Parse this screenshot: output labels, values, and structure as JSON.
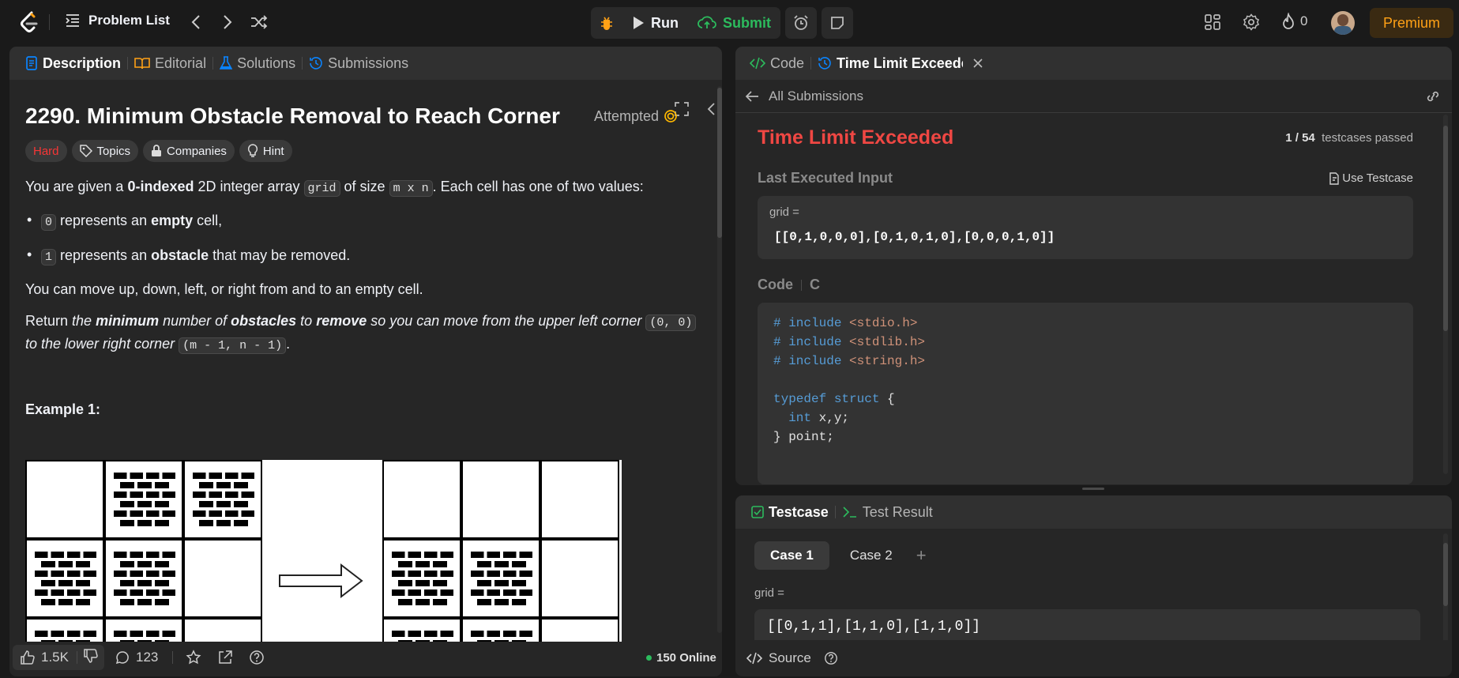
{
  "topbar": {
    "problem_list": "Problem List",
    "run": "Run",
    "submit": "Submit",
    "streak": "0",
    "premium": "Premium"
  },
  "left": {
    "tabs": [
      "Description",
      "Editorial",
      "Solutions",
      "Submissions"
    ],
    "title": "2290. Minimum Obstacle Removal to Reach Corner",
    "status": "Attempted",
    "difficulty": "Hard",
    "tags": [
      "Topics",
      "Companies",
      "Hint"
    ],
    "p1": {
      "a": "You are given a ",
      "b": "0-indexed",
      "c": " 2D integer array ",
      "code1": "grid",
      "d": " of size ",
      "code2": "m x n",
      "e": ". Each cell has one of two values:"
    },
    "b1": {
      "code": "0",
      "a": " represents an ",
      "b": "empty",
      "c": " cell,"
    },
    "b2": {
      "code": "1",
      "a": " represents an ",
      "b": "obstacle",
      "c": " that may be removed."
    },
    "p2": "You can move up, down, left, or right from and to an empty cell.",
    "p3": {
      "a": "Return ",
      "b": "the ",
      "c": "minimum",
      "d": " number of ",
      "e": "obstacles",
      "f": " to ",
      "g": "remove",
      "h": " so you can move from the upper left corner ",
      "code1": "(0, 0)",
      "i": " to the lower right corner ",
      "code2": "(m - 1, n - 1)",
      "j": "."
    },
    "example": "Example 1:",
    "footer": {
      "likes": "1.5K",
      "comments": "123",
      "online": "150 Online"
    }
  },
  "right_top": {
    "tabs": [
      "Code",
      "Time Limit Exceeded"
    ],
    "back": "All Submissions",
    "verdict": "Time Limit Exceeded",
    "passed": "1 / 54",
    "passed_label": "testcases passed",
    "last_input_label": "Last Executed Input",
    "use_testcase": "Use Testcase",
    "input_var": "grid =",
    "input_value": "[[0,1,0,0,0],[0,1,0,1,0],[0,0,0,1,0]]",
    "code_label": "Code",
    "lang": "C",
    "code_lines": [
      {
        "kw": "# include ",
        "str": "<stdio.h>"
      },
      {
        "kw": "# include ",
        "str": "<stdlib.h>"
      },
      {
        "kw": "# include ",
        "str": "<string.h>"
      },
      {
        "kw": "",
        "str": ""
      },
      {
        "kw": "typedef struct",
        "rest": " {"
      },
      {
        "kw": "  int",
        "rest": " x,y;"
      },
      {
        "kw": "",
        "rest": "} point;"
      }
    ]
  },
  "right_bottom": {
    "tabs": [
      "Testcase",
      "Test Result"
    ],
    "cases": [
      "Case 1",
      "Case 2"
    ],
    "add": "+",
    "var": "grid =",
    "value": "[[0,1,1],[1,1,0],[1,1,0]]",
    "source": "Source"
  },
  "colors": {
    "accent": "#ffa116",
    "hard": "#f63636",
    "easy_green": "#2cbb5d",
    "tle_red": "#ef4743",
    "link_blue": "#0a84ff"
  },
  "example_grid": {
    "left": [
      [
        0,
        1,
        1
      ],
      [
        1,
        1,
        0
      ],
      [
        1,
        1,
        0
      ]
    ],
    "right": [
      [
        0,
        0,
        0
      ],
      [
        1,
        1,
        0
      ],
      [
        1,
        1,
        0
      ]
    ]
  }
}
